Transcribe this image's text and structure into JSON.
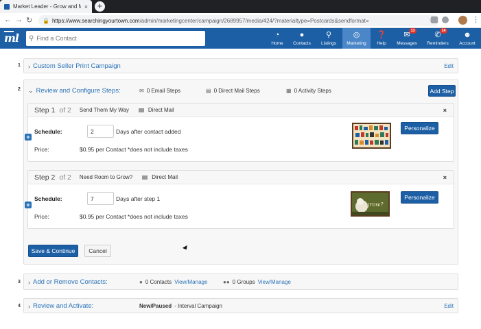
{
  "browser": {
    "tab_title": "Market Leader - Grow and Mana",
    "tab_close": "×",
    "new_tab": "+",
    "url_host": "https://www.searchingyourtown.com",
    "url_path": "/admin/marketingcenter/campaign/2689957/media/424/?materialtype=Postcards&sendformat="
  },
  "app": {
    "logo": "ml",
    "search_placeholder": "Find a Contact",
    "nav": [
      {
        "label": "Home",
        "icon": "dashboard-icon"
      },
      {
        "label": "Contacts",
        "icon": "contacts-icon"
      },
      {
        "label": "Listings",
        "icon": "map-pin-icon"
      },
      {
        "label": "Marketing",
        "icon": "target-icon"
      },
      {
        "label": "Help",
        "icon": "help-icon"
      },
      {
        "label": "Messages",
        "icon": "envelope-icon",
        "badge": "13"
      },
      {
        "label": "Reminders",
        "icon": "bell-icon",
        "badge": "14"
      },
      {
        "label": "Account",
        "icon": "user-icon"
      }
    ],
    "active_nav": "Marketing"
  },
  "sections": {
    "s1": {
      "num": "1",
      "title": "Custom Seller Print Campaign",
      "edit": "Edit"
    },
    "s2": {
      "num": "2",
      "title": "Review and Configure Steps:",
      "email_steps": "0 Email Steps",
      "direct_mail_steps": "0 Direct Mail Steps",
      "activity_steps": "0 Activity Steps",
      "add_step": "Add Step",
      "save_continue": "Save & Continue",
      "cancel": "Cancel"
    },
    "s3": {
      "num": "3",
      "title": "Add or Remove Contacts:",
      "contacts": "0 Contacts",
      "contacts_link": "View/Manage",
      "groups": "0 Groups",
      "groups_link": "View/Manage"
    },
    "s4": {
      "num": "4",
      "title": "Review and Activate:",
      "status": "New/Paused",
      "status_detail": " - Interval Campaign",
      "edit": "Edit"
    }
  },
  "steps": [
    {
      "step": "Step 1",
      "of": "of 2",
      "name": "Send Them My Way",
      "type": "Direct Mail",
      "schedule_label": "Schedule:",
      "days": "2",
      "days_text": "Days after contact added",
      "price_label": "Price:",
      "price_text": "$0.95 per Contact *does not include taxes",
      "personalize": "Personalize",
      "close": "×"
    },
    {
      "step": "Step 2",
      "of": "of 2",
      "name": "Need Room to Grow?",
      "type": "Direct Mail",
      "schedule_label": "Schedule:",
      "days": "7",
      "days_text": "Days after step 1",
      "price_label": "Price:",
      "price_text": "$0.95 per Contact *does not include taxes",
      "personalize": "Personalize",
      "close": "×"
    }
  ],
  "postcard2_text": "grow?"
}
